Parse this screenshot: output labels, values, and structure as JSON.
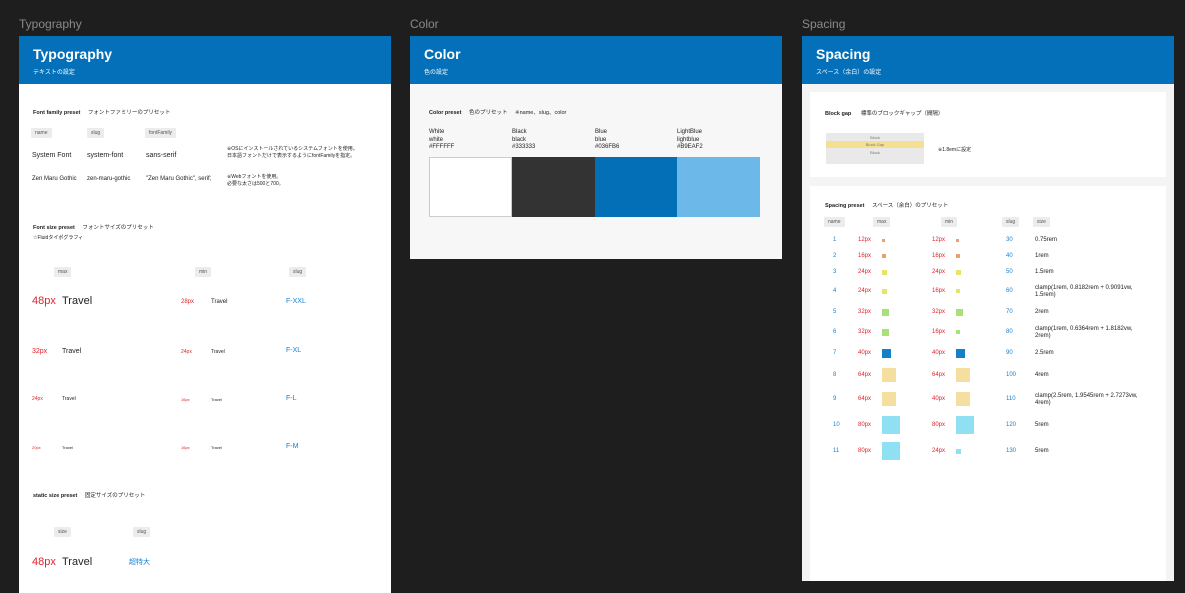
{
  "frames": {
    "typography": {
      "label": "Typography",
      "title": "Typography",
      "subtitle": "テキストの設定"
    },
    "color": {
      "label": "Color",
      "title": "Color",
      "subtitle": "色の設定"
    },
    "spacing": {
      "label": "Spacing",
      "title": "Spacing",
      "subtitle": "スペース（余白）の設定"
    }
  },
  "typography": {
    "family": {
      "heading": "Font family preset",
      "heading_jp": "フォントファミリーのプリセット",
      "headers": [
        "name",
        "slug",
        "fontFamily"
      ],
      "rows": [
        {
          "name": "System Font",
          "slug": "system-font",
          "family": "sans-serif"
        },
        {
          "name": "Zen Maru Gothic",
          "slug": "zen-maru-gothic",
          "family": "\"Zen Maru Gothic\", serif;"
        }
      ],
      "note1": "※OSにインストールされているシステムフォントを使用。\n日本語フォントだけで表示するようにfontFamilyを指定。",
      "note2": "※Webフォントを使用。\n必要な太さは500と700。"
    },
    "size": {
      "heading": "Font size preset",
      "heading_jp": "フォントサイズのプリセット",
      "sub": "☆Fluidタイポグラフィ",
      "headers": [
        "max",
        "min",
        "slug"
      ],
      "rows": [
        {
          "max": "48px",
          "sample": "Travel",
          "min": "28px",
          "sample_min": "Travel",
          "slug": "F-XXL"
        },
        {
          "max": "32px",
          "sample": "Travel",
          "min": "24px",
          "sample_min": "Travel",
          "slug": "F-XL"
        },
        {
          "max": "24px",
          "sample": "Travel",
          "min": "16px",
          "sample_min": "Travel",
          "slug": "F-L"
        },
        {
          "max": "20px",
          "sample": "Travel",
          "min": "16px",
          "sample_min": "Travel",
          "slug": "F-M"
        }
      ]
    },
    "static": {
      "heading": "static size preset",
      "heading_jp": "固定サイズのプリセット",
      "headers": [
        "size",
        "slug"
      ],
      "row": {
        "size": "48px",
        "sample": "Travel",
        "slug": "超特大"
      }
    }
  },
  "color": {
    "heading": "Color preset",
    "heading_jp": "色のプリセット",
    "note": "※name、slug、color",
    "swatches": [
      {
        "name": "White",
        "slug": "white",
        "hex": "#FFFFFF",
        "color": "#ffffff"
      },
      {
        "name": "Black",
        "slug": "black",
        "hex": "#333333",
        "color": "#333333"
      },
      {
        "name": "Blue",
        "slug": "blue",
        "hex": "#036FB6",
        "color": "#036fb6"
      },
      {
        "name": "LightBlue",
        "slug": "lightblue",
        "hex": "#B9EAF2",
        "color": "#6cb8e8"
      }
    ]
  },
  "spacing": {
    "gap": {
      "heading": "Block gap",
      "heading_jp": "標準のブロックギャップ（間隔）",
      "block1": "Block",
      "gap_label": "Block Gap",
      "block2": "Block",
      "note": "※1.8emに設定"
    },
    "preset": {
      "heading": "Spacing preset",
      "heading_jp": "スペース（余白）のプリセット",
      "headers": [
        "name",
        "max",
        "min",
        "slug",
        "size"
      ],
      "rows": [
        {
          "name": "1",
          "max": "12px",
          "min": "12px",
          "slug": "30",
          "size": "0.75rem",
          "maxc": "#e8a070",
          "minc": "#e8a070",
          "maxs": 3,
          "mins": 3
        },
        {
          "name": "2",
          "max": "16px",
          "min": "16px",
          "slug": "40",
          "size": "1rem",
          "maxc": "#e8a070",
          "minc": "#e8a070",
          "maxs": 4,
          "mins": 4
        },
        {
          "name": "3",
          "max": "24px",
          "min": "24px",
          "slug": "50",
          "size": "1.5rem",
          "maxc": "#e4e56a",
          "minc": "#e4e56a",
          "maxs": 5,
          "mins": 5
        },
        {
          "name": "4",
          "max": "24px",
          "min": "16px",
          "slug": "60",
          "size": "clamp(1rem, 0.8182rem + 0.9091vw, 1.5rem)",
          "maxc": "#e4e56a",
          "minc": "#e4e56a",
          "maxs": 5,
          "mins": 4
        },
        {
          "name": "5",
          "max": "32px",
          "min": "32px",
          "slug": "70",
          "size": "2rem",
          "maxc": "#a9e07a",
          "minc": "#a9e07a",
          "maxs": 7,
          "mins": 7
        },
        {
          "name": "6",
          "max": "32px",
          "min": "16px",
          "slug": "80",
          "size": "clamp(1rem, 0.6364rem + 1.8182vw, 2rem)",
          "maxc": "#a9e07a",
          "minc": "#a9e07a",
          "maxs": 7,
          "mins": 4
        },
        {
          "name": "7",
          "max": "40px",
          "min": "40px",
          "slug": "90",
          "size": "2.5rem",
          "maxc": "#1480c8",
          "minc": "#1480c8",
          "maxs": 9,
          "mins": 9
        },
        {
          "name": "8",
          "max": "64px",
          "min": "64px",
          "slug": "100",
          "size": "4rem",
          "maxc": "#f5dfa0",
          "minc": "#f5dfa0",
          "maxs": 14,
          "mins": 14
        },
        {
          "name": "9",
          "max": "64px",
          "min": "40px",
          "slug": "110",
          "size": "clamp(2.5rem, 1.9545rem + 2.7273vw, 4rem)",
          "maxc": "#f5dfa0",
          "minc": "#f5dfa0",
          "maxs": 14,
          "mins": 14
        },
        {
          "name": "10",
          "max": "80px",
          "min": "80px",
          "slug": "120",
          "size": "5rem",
          "maxc": "#8fe0f2",
          "minc": "#8fe0f2",
          "maxs": 18,
          "mins": 18
        },
        {
          "name": "11",
          "max": "80px",
          "min": "24px",
          "slug": "130",
          "size": "5rem",
          "maxc": "#8fe0f2",
          "minc": "#8fe0f2",
          "maxs": 18,
          "mins": 5
        }
      ]
    }
  }
}
